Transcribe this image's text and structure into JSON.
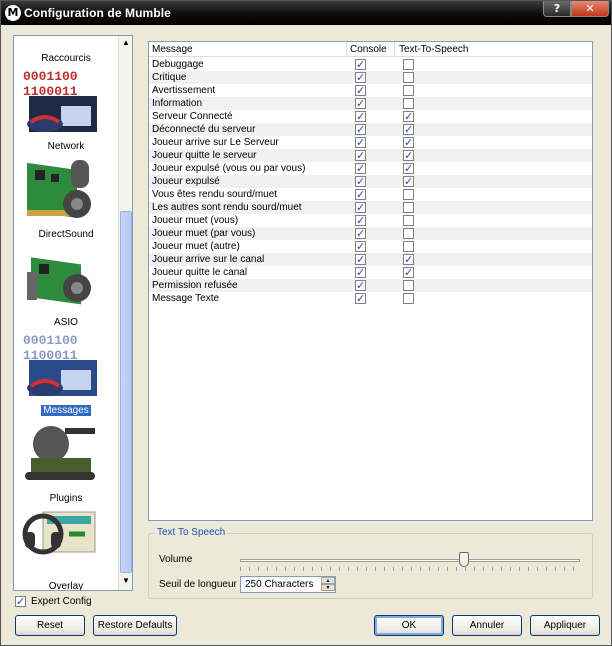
{
  "window": {
    "title": "Configuration de Mumble",
    "help_glyph": "?",
    "close_glyph": "✕"
  },
  "sidebar": {
    "items": [
      {
        "label": "Raccourcis",
        "icon": "keyboard-icon"
      },
      {
        "label": "Network",
        "icon": "network-icon"
      },
      {
        "label": "DirectSound",
        "icon": "sound-card-icon"
      },
      {
        "label": "ASIO",
        "icon": "asio-card-icon"
      },
      {
        "label": "Messages",
        "icon": "messages-icon",
        "selected": true
      },
      {
        "label": "Plugins",
        "icon": "plugins-icon"
      },
      {
        "label": "Overlay",
        "icon": "overlay-icon"
      }
    ],
    "binary_top": "0001100",
    "binary_bottom": "1100011"
  },
  "table": {
    "headers": {
      "message": "Message",
      "console": "Console",
      "tts": "Text-To-Speech"
    },
    "rows": [
      {
        "name": "Debuggage",
        "console": true,
        "tts": false
      },
      {
        "name": "Critique",
        "console": true,
        "tts": false
      },
      {
        "name": "Avertissement",
        "console": true,
        "tts": false
      },
      {
        "name": "Information",
        "console": true,
        "tts": false
      },
      {
        "name": "Serveur Connecté",
        "console": true,
        "tts": true
      },
      {
        "name": "Déconnecté du serveur",
        "console": true,
        "tts": true
      },
      {
        "name": "Joueur arrive sur Le Serveur",
        "console": true,
        "tts": true
      },
      {
        "name": "Joueur quitte le serveur",
        "console": true,
        "tts": true
      },
      {
        "name": "Joueur expulsé (vous ou par vous)",
        "console": true,
        "tts": true
      },
      {
        "name": "Joueur expulsé",
        "console": true,
        "tts": true
      },
      {
        "name": "Vous êtes rendu sourd/muet",
        "console": true,
        "tts": false
      },
      {
        "name": "Les autres sont rendu sourd/muet",
        "console": true,
        "tts": false
      },
      {
        "name": "Joueur muet (vous)",
        "console": true,
        "tts": false
      },
      {
        "name": "Joueur muet (par vous)",
        "console": true,
        "tts": false
      },
      {
        "name": "Joueur muet (autre)",
        "console": true,
        "tts": false
      },
      {
        "name": "Joueur arrive sur le canal",
        "console": true,
        "tts": true
      },
      {
        "name": "Joueur quitte le canal",
        "console": true,
        "tts": true
      },
      {
        "name": "Permission refusée",
        "console": true,
        "tts": false
      },
      {
        "name": "Message Texte",
        "console": true,
        "tts": false
      }
    ]
  },
  "tts": {
    "legend": "Text To Speech",
    "volume_label": "Volume",
    "volume_value": 0.66,
    "threshold_label": "Seuil de longueur",
    "threshold_value": "250 Characters"
  },
  "expert": {
    "label": "Expert Config",
    "checked": true
  },
  "buttons": {
    "reset": "Reset",
    "restore": "Restore Defaults",
    "ok": "OK",
    "cancel": "Annuler",
    "apply": "Appliquer"
  },
  "colors": {
    "accent": "#316ac5",
    "legend": "#1c4fb3",
    "check": "#1c4fb3"
  }
}
